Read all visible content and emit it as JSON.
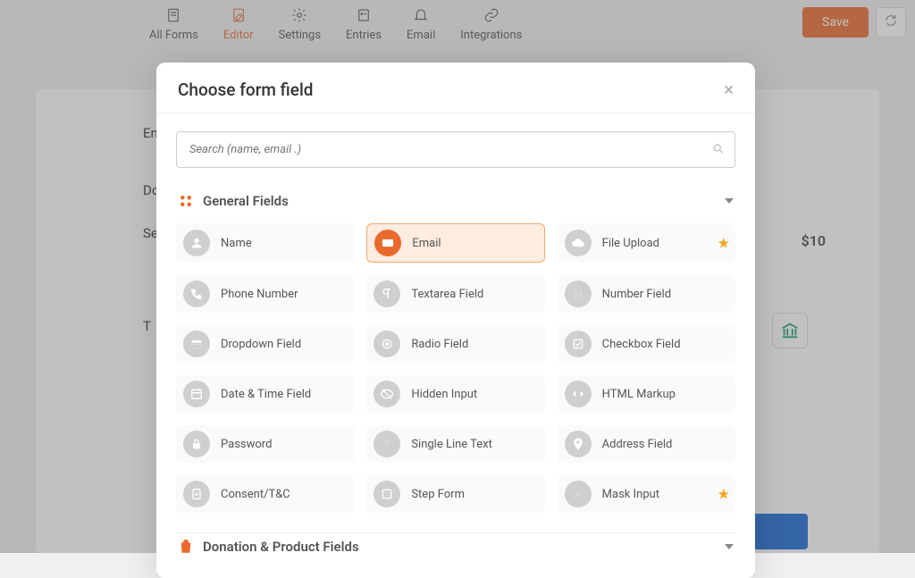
{
  "nav": {
    "all_forms": "All Forms",
    "editor": "Editor",
    "settings": "Settings",
    "entries": "Entries",
    "email": "Email",
    "integrations": "Integrations"
  },
  "buttons": {
    "save": "Save"
  },
  "bg": {
    "label1": "En",
    "label2": "Do",
    "label3": "Se",
    "label4": "T",
    "price": "$10"
  },
  "modal": {
    "title": "Choose form field",
    "search_placeholder": "Search (name, email .)",
    "sections": {
      "general": "General Fields",
      "donation": "Donation & Product Fields"
    },
    "fields": {
      "name": "Name",
      "email": "Email",
      "file_upload": "File Upload",
      "phone": "Phone Number",
      "textarea": "Textarea Field",
      "number": "Number Field",
      "dropdown": "Dropdown Field",
      "radio": "Radio Field",
      "checkbox": "Checkbox Field",
      "datetime": "Date & Time Field",
      "hidden": "Hidden Input",
      "html": "HTML Markup",
      "password": "Password",
      "single_line": "Single Line Text",
      "address": "Address Field",
      "consent": "Consent/T&C",
      "step": "Step Form",
      "mask": "Mask Input"
    }
  }
}
